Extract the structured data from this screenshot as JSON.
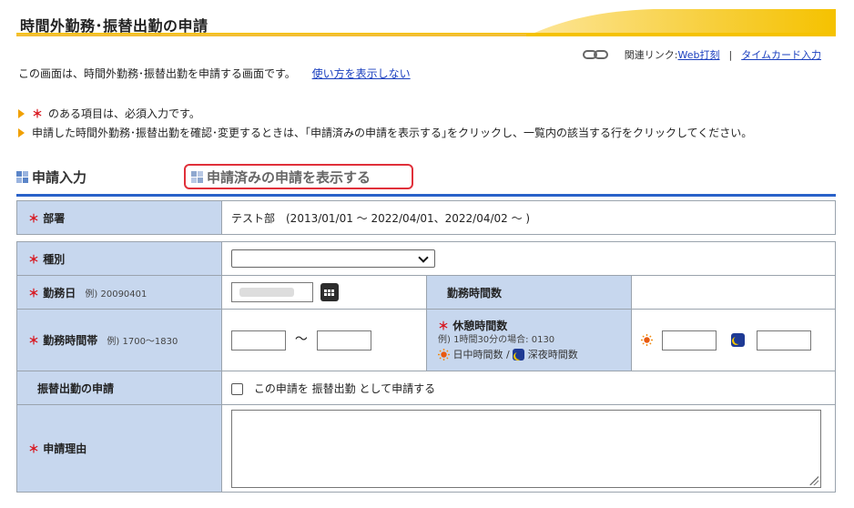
{
  "header": {
    "title": "時間外勤務･振替出勤の申請"
  },
  "related_links": {
    "label": "関連リンク:",
    "web_punch": "Web打刻",
    "separator": "|",
    "timecard": "タイムカード入力",
    "icon": "link-chain-icon"
  },
  "intro": {
    "text": "この画面は、時間外勤務･振替出勤を申請する画面です。",
    "hide_usage_link": "使い方を表示しない"
  },
  "notes": {
    "required_mark": "＊",
    "required_text": "のある項目は、必須入力です。",
    "confirm_text": "申請した時間外勤務･振替出勤を確認･変更するときは、｢申請済みの申請を表示する｣をクリックし、一覧内の該当する行をクリックしてください。"
  },
  "section": {
    "title": "申請入力",
    "show_submitted_button": "申請済みの申請を表示する"
  },
  "form": {
    "req_mark": "＊",
    "department": {
      "label": "部署",
      "value": "テスト部　(2013/01/01 ～ 2022/04/01、2022/04/02 ～ )"
    },
    "type": {
      "label": "種別",
      "selected": ""
    },
    "work_date": {
      "label": "勤務日",
      "example": "例) 20090401"
    },
    "work_hours": {
      "label": "勤務時間数",
      "value": ""
    },
    "work_time_range": {
      "label": "勤務時間帯",
      "example": "例) 1700～1830",
      "tilde": "～"
    },
    "break_hours": {
      "label": "休憩時間数",
      "example": "例) 1時間30分の場合: 0130",
      "day_label": "日中時間数",
      "slash": "/",
      "night_label": "深夜時間数"
    },
    "substitute": {
      "label": "振替出勤の申請",
      "checkbox_text": "この申請を 振替出勤 として申請する"
    },
    "reason": {
      "label": "申請理由",
      "value": ""
    }
  },
  "colors": {
    "accent_blue": "#2a62c9",
    "label_bg": "#c7d7ee",
    "required_red": "#d8141c",
    "title_gold": "#f5c200"
  }
}
